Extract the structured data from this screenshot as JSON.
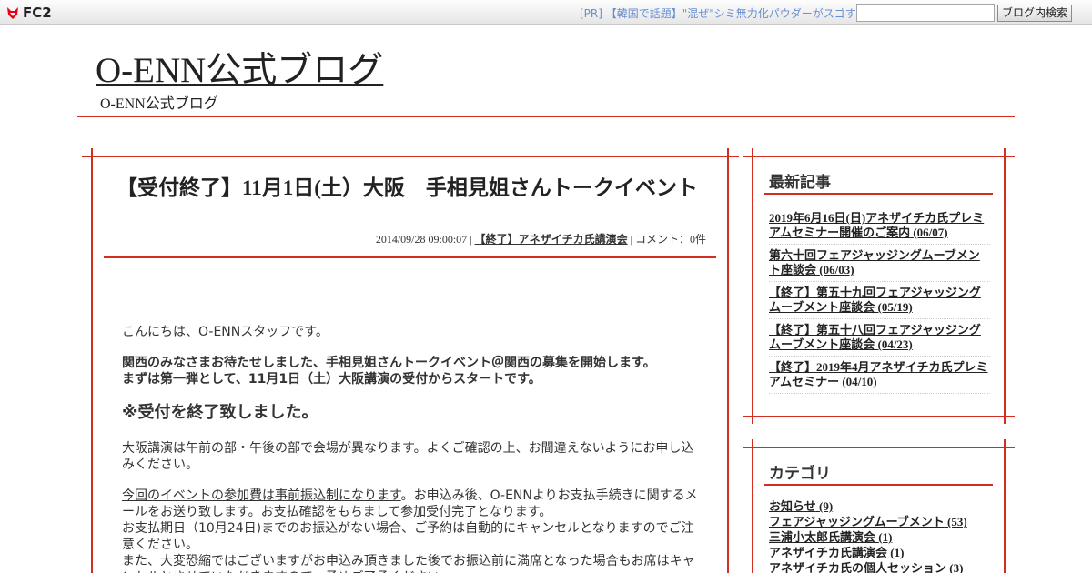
{
  "fc2bar": {
    "logo_text": "FC2",
    "pr_text": "[PR] 【韓国で話題】\"混ぜ\"シミ無力化パウダーがスゴす",
    "search_value": "",
    "search_button": "ブログ内検索"
  },
  "header": {
    "title": "O-ENN公式ブログ",
    "description": "O-ENN公式ブログ"
  },
  "post": {
    "title": "【受付終了】11月1日(土）大阪　手相見姐さんトークイベント",
    "date": "2014/09/28 09:00:07 |",
    "category": "【終了】アネザイチカ氏講演会",
    "comments": "| コメント：0件",
    "body": {
      "greeting": "こんにちは、O-ENNスタッフです。",
      "announce_1": "関西のみなさまお待たせしました、手相見姐さんトークイベント＠関西の募集を開始します。",
      "announce_2": "まずは第一弾として、11月1日（土）大阪講演の受付からスタートです。",
      "closed_notice": "※受付を終了致しました。",
      "para_venue": "大阪講演は午前の部・午後の部で会場が異なります。よくご確認の上、お間違えないようにお申し込みください。",
      "para_fee_link": "今回のイベントの参加費は事前振込制になります",
      "para_fee_rest": "。お申込み後、O-ENNよりお支払手続きに関するメールをお送り致します。お支払確認をもちまして参加受付完了となります。",
      "para_deadline": "お支払期日（10月24日)までのお振込がない場合、ご予約は自動的にキャンセルとなりますのでご注意ください。",
      "para_sorry": "また、大変恐縮ではございますがお申込み頂きました後でお振込前に満席となった場合もお席はキャンセルとさせていただきますので、予めご了承ください。"
    }
  },
  "sidebar": {
    "recent_heading": "最新記事",
    "recent": [
      {
        "title": "2019年6月16日(日)アネザイチカ氏プレミアムセミナー開催のご案内",
        "date": "(06/07)"
      },
      {
        "title": "第六十回フェアジャッジングムーブメント座談会",
        "date": "(06/03)"
      },
      {
        "title": "【終了】第五十九回フェアジャッジングムーブメント座談会",
        "date": "(05/19)"
      },
      {
        "title": "【終了】第五十八回フェアジャッジングムーブメント座談会",
        "date": "(04/23)"
      },
      {
        "title": "【終了】2019年4月アネザイチカ氏プレミアムセミナー",
        "date": "(04/10)"
      }
    ],
    "category_heading": "カテゴリ",
    "categories": [
      {
        "name": "お知らせ",
        "count": "(9)"
      },
      {
        "name": "フェアジャッジングムーブメント",
        "count": "(53)"
      },
      {
        "name": "三浦小太郎氏講演会",
        "count": "(1)"
      },
      {
        "name": "アネザイチカ氏講演会",
        "count": "(1)"
      },
      {
        "name": "アネザイチカ氏の個人セッション",
        "count": "(3)"
      }
    ]
  },
  "colors": {
    "accent_red": "#d22d1e",
    "pr_link": "#6a8fd0"
  }
}
